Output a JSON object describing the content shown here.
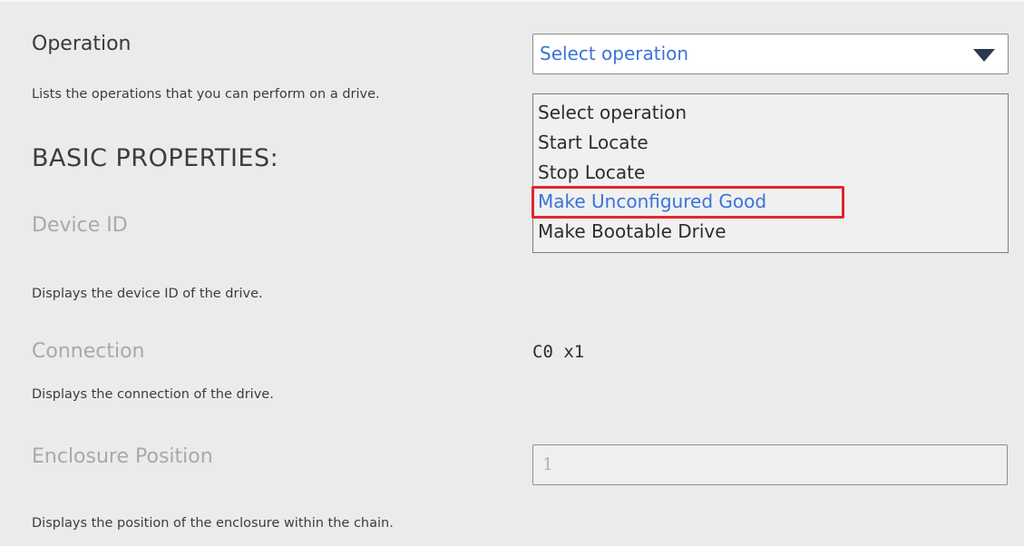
{
  "operation": {
    "label": "Operation",
    "description": "Lists the operations that you can perform on a drive.",
    "select_value": "Select operation",
    "dropdown_options": [
      "Select operation",
      "Start Locate",
      "Stop Locate",
      "Make Unconfigured Good",
      "Make Bootable Drive"
    ],
    "highlighted_option": "Make Unconfigured Good"
  },
  "basic_properties": {
    "heading": "BASIC PROPERTIES:"
  },
  "device_id": {
    "label": "Device ID",
    "description": "Displays the device ID of the drive."
  },
  "connection": {
    "label": "Connection",
    "value": "C0 x1",
    "description": "Displays the connection of the drive."
  },
  "enclosure_position": {
    "label": "Enclosure Position",
    "value": "1",
    "description": "Displays the position of the enclosure within the chain."
  },
  "colors": {
    "selected_text": "#3b73d9",
    "highlight_border": "#e0262d",
    "panel_background": "#ebebeb"
  },
  "icons": {
    "dropdown_caret": "triangle-down-icon"
  }
}
